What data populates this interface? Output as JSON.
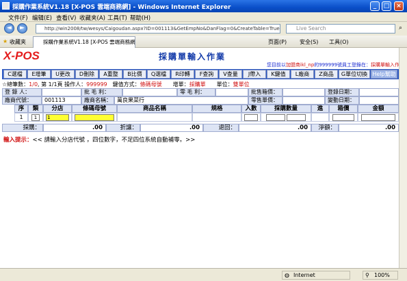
{
  "window": {
    "title": "採購作業系統V1.18 [X-POS 雲端商務網] - Windows Internet Explorer"
  },
  "menu": [
    "文件(F)",
    "编辑(E)",
    "查看(V)",
    "收藏夹(A)",
    "工具(T)",
    "帮助(H)"
  ],
  "address": {
    "url": "http://win2008/tw/wesys/Caigoudan.aspx?ID=001113&GetEmpNo&DanFlag=0&CreateTable=True",
    "search_placeholder": "Live Search"
  },
  "favorites": {
    "label": "收藏夹",
    "tab_title": "採購作業系統V1.18 [X-POS 雲端商務網]",
    "tools": [
      "页面(P)",
      "安全(S)",
      "工具(O)"
    ]
  },
  "app": {
    "logo": "X-POS",
    "page_title": "採購單輸入作業",
    "info_prefix": "您目前以",
    "info_user": "加盟商ikl_np",
    "info_mid": "的999999號員工登錄在：",
    "info_page": "採購單輸入作業"
  },
  "buttons": [
    "C選檔",
    "E增筆",
    "U更改",
    "D刪除",
    "A重整",
    "B比價",
    "Q選檔",
    "R印轉",
    "F查詢",
    "V查量",
    "J帶入",
    "K鍵值",
    "L廠商",
    "Z商品",
    "G單位切換",
    "Help幫助"
  ],
  "status": {
    "prefix": "☆總筆數：",
    "count": "1/0",
    "page": "第 1/1頁",
    "operator_label": "操作人：",
    "operator": "999999",
    "keymode_label": "鍵值方式：",
    "keymode": "條碼母號",
    "add_label": "增單：",
    "add_value": "採購單",
    "unit_label": "單位：",
    "unit_value": "雙單位"
  },
  "form": {
    "reg_person_label": "登 錄 人：",
    "reg_person": "",
    "gross_label": "批 毛 利：",
    "gross": "",
    "retail_gross_label": "零 毛 利：",
    "retail_gross": "",
    "wholesale_label": "批售箱價：",
    "wholesale": "",
    "reg_date_label": "登錄日期：",
    "reg_date": "",
    "vendor_code_label": "廠商代號：",
    "vendor_code": "001113",
    "vendor_name_label": "廠商名稱：",
    "vendor_name": "萬良果菜行",
    "retail_price_label": "零售單價：",
    "retail_price": "",
    "change_date_label": "變動日期：",
    "change_date": ""
  },
  "table": {
    "headers": [
      "序",
      "類",
      "分店",
      "條碼母號",
      "商品名稱",
      "規格",
      "入數",
      "採購數量",
      "進",
      "箱價",
      "金額"
    ],
    "row": {
      "seq": "1",
      "cls": "1",
      "branch": "1"
    }
  },
  "summary": {
    "purchase_label": "採購：",
    "purchase": ".00",
    "discount_label": "折讓：",
    "discount": ".00",
    "return_label": "退回：",
    "return": ".00",
    "net_label": "淨額：",
    "net": ".00"
  },
  "hint": {
    "label": "輸入提示：",
    "text": "<< 請輸入分店代號 ，四位數字，不足四位系統自動補零。>>"
  },
  "statusbar": {
    "zone": "Internet",
    "zoom": "100%"
  },
  "colors": {
    "accent": "#2a58c4",
    "red": "#d01010",
    "header": "#1038a8"
  }
}
